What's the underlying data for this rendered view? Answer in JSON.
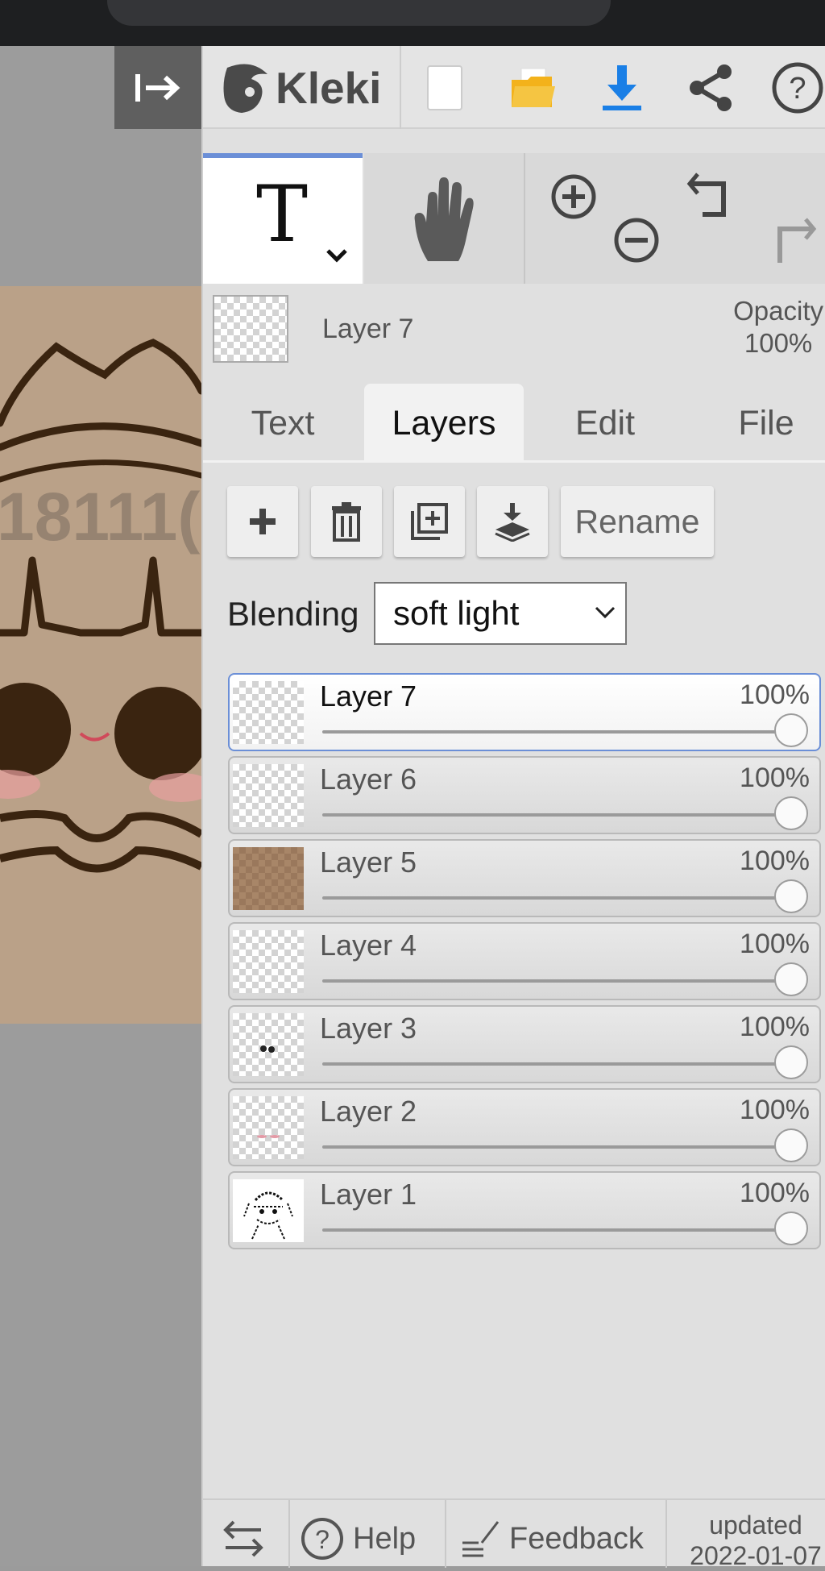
{
  "app": {
    "title": "Kleki"
  },
  "toolbar": {
    "new_icon": "new-document-icon",
    "open_icon": "open-folder-icon",
    "save_icon": "download-icon",
    "share_icon": "share-icon",
    "help_icon": "help-icon"
  },
  "tools": {
    "text_glyph": "T",
    "hand_icon": "hand-icon",
    "zoom_in_icon": "zoom-in-icon",
    "zoom_out_icon": "zoom-out-icon",
    "undo_icon": "undo-icon",
    "redo_icon": "redo-icon"
  },
  "current_layer": {
    "name": "Layer 7",
    "opacity_label": "Opacity",
    "opacity_value": "100%"
  },
  "tabs": [
    "Text",
    "Layers",
    "Edit",
    "File"
  ],
  "active_tab": "Layers",
  "layer_actions": {
    "add_icon": "add-layer-icon",
    "delete_icon": "delete-layer-icon",
    "duplicate_icon": "duplicate-layer-icon",
    "merge_icon": "merge-down-icon",
    "rename_label": "Rename"
  },
  "blending": {
    "label": "Blending",
    "value": "soft light"
  },
  "layers": [
    {
      "name": "Layer 7",
      "opacity": "100%",
      "selected": true
    },
    {
      "name": "Layer 6",
      "opacity": "100%"
    },
    {
      "name": "Layer 5",
      "opacity": "100%"
    },
    {
      "name": "Layer 4",
      "opacity": "100%"
    },
    {
      "name": "Layer 3",
      "opacity": "100%"
    },
    {
      "name": "Layer 2",
      "opacity": "100%"
    },
    {
      "name": "Layer 1",
      "opacity": "100%"
    }
  ],
  "canvas_watermark": "18111(",
  "footer": {
    "swap_icon": "swap-icon",
    "help_label": "Help",
    "feedback_label": "Feedback",
    "updated_label": "updated",
    "updated_date": "2022-01-07"
  },
  "colors": {
    "accent": "#6b8fd7",
    "download": "#1a7fe6",
    "folder": "#f3b21b",
    "skin": "#baa188"
  }
}
